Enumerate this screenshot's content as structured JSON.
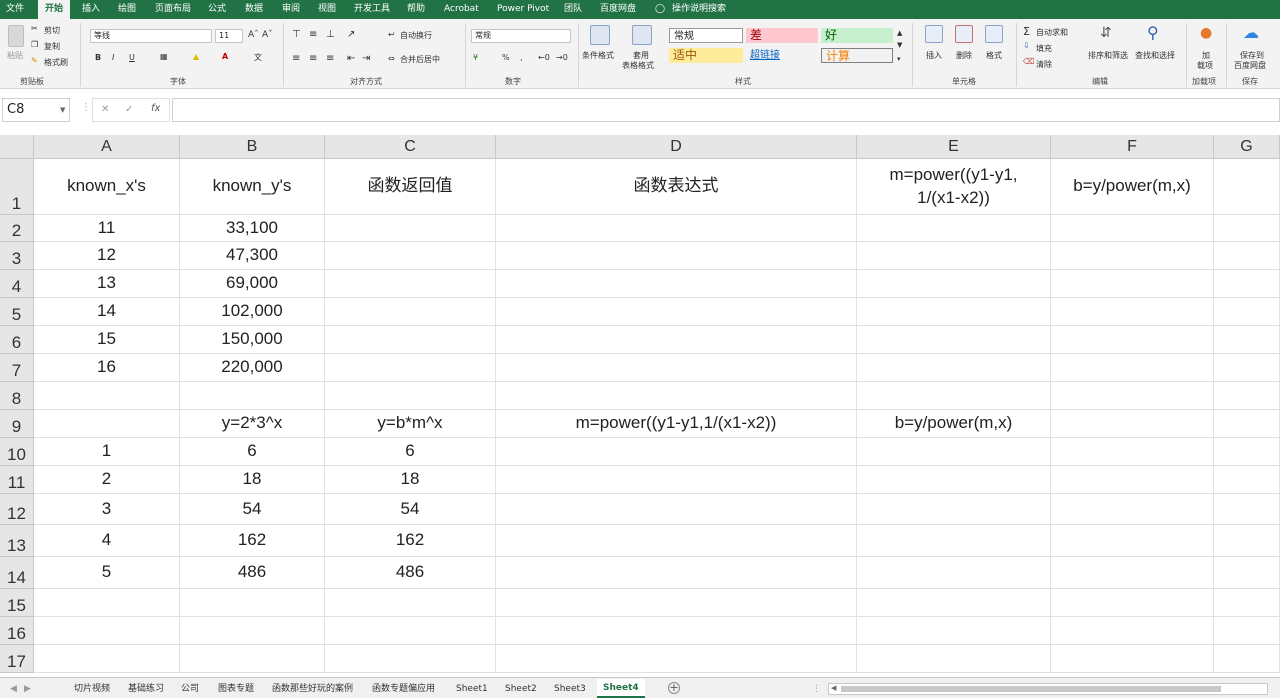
{
  "ribbon_tabs": [
    "文件",
    "开始",
    "插入",
    "绘图",
    "页面布局",
    "公式",
    "数据",
    "审阅",
    "视图",
    "开发工具",
    "帮助",
    "Acrobat",
    "Power Pivot",
    "团队",
    "百度网盘"
  ],
  "tell_me": "操作说明搜索",
  "clipboard": {
    "paste": "粘贴",
    "cut": "剪切",
    "copy": "复制",
    "format_painter": "格式刷",
    "group": "剪贴板"
  },
  "font": {
    "name": "等线",
    "size": "11",
    "bold": "B",
    "italic": "I",
    "underline": "U",
    "group": "字体"
  },
  "alignment": {
    "wrap": "自动换行",
    "merge": "合并后居中",
    "group": "对齐方式"
  },
  "number": {
    "format": "常规",
    "percent": "%",
    "comma": ",",
    "group": "数字"
  },
  "styles": {
    "conditional": "条件格式",
    "table1": "套用",
    "table2": "表格格式",
    "normal": "常规",
    "bad": "差",
    "good": "好",
    "neutral": "适中",
    "hyperlink": "超链接",
    "calc": "计算",
    "group": "样式"
  },
  "cells": {
    "insert": "插入",
    "delete": "删除",
    "format": "格式",
    "group": "单元格"
  },
  "editing": {
    "autosum": "自动求和",
    "fill": "填充",
    "clear": "清除",
    "sort": "排序和筛选",
    "find": "查找和选择",
    "group": "编辑"
  },
  "addins": {
    "label1": "加",
    "label2": "载项",
    "group": "加载项"
  },
  "save": {
    "label1": "保存到",
    "label2": "百度网盘",
    "group": "保存"
  },
  "namebox": "C8",
  "fx": "fx",
  "columns": [
    "A",
    "B",
    "C",
    "D",
    "E",
    "F",
    "G"
  ],
  "rows": [
    "1",
    "2",
    "3",
    "4",
    "5",
    "6",
    "7",
    "8",
    "9",
    "10",
    "11",
    "12",
    "13",
    "14",
    "15",
    "16",
    "17"
  ],
  "cells_data": {
    "r1": [
      "known_x's",
      "known_y's",
      "函数返回值",
      "函数表达式",
      "m=power((y1-y1,1/(x1-x2))",
      "b=y/power(m,x)"
    ],
    "r2": [
      "11",
      "33,100"
    ],
    "r3": [
      "12",
      "47,300"
    ],
    "r4": [
      "13",
      "69,000"
    ],
    "r5": [
      "14",
      "102,000"
    ],
    "r6": [
      "15",
      "150,000"
    ],
    "r7": [
      "16",
      "220,000"
    ],
    "r9": [
      "",
      "y=2*3^x",
      "y=b*m^x",
      "m=power((y1-y1,1/(x1-x2))",
      "b=y/power(m,x)"
    ],
    "r10": [
      "1",
      "6",
      "6"
    ],
    "r11": [
      "2",
      "18",
      "18"
    ],
    "r12": [
      "3",
      "54",
      "54"
    ],
    "r13": [
      "4",
      "162",
      "162"
    ],
    "r14": [
      "5",
      "486",
      "486"
    ]
  },
  "sheet_tabs": [
    "切片视频",
    "基础练习",
    "公司",
    "图表专题",
    "函数那些好玩的案例",
    "函数专题偏应用",
    "Sheet1",
    "Sheet2",
    "Sheet3",
    "Sheet4"
  ],
  "add_sheet": "+"
}
